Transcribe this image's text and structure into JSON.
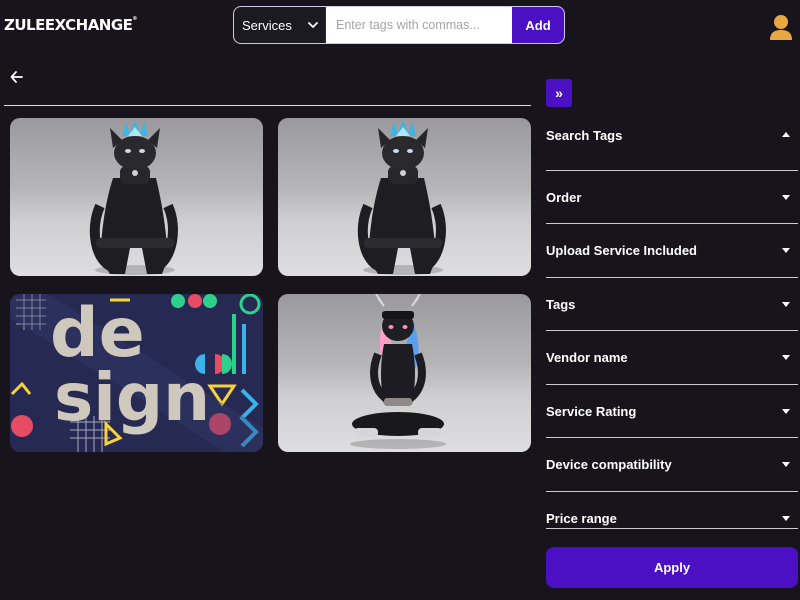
{
  "header": {
    "logo_text": "ZULEEXCHANGE",
    "logo_mark": "®",
    "search": {
      "category_selected": "Services",
      "placeholder": "Enter tags with commas...",
      "add_label": "Add"
    },
    "avatar_icon": "user-avatar-icon"
  },
  "main": {
    "back_icon": "arrow-left-icon",
    "items": [
      {
        "kind": "avatar-render",
        "title": "Black cat avatar with blue flame crown, seated"
      },
      {
        "kind": "avatar-render",
        "title": "Black cat avatar with blue flame crown, seated"
      },
      {
        "kind": "design-banner",
        "banner_text_1": "de",
        "banner_text_2": "sign"
      },
      {
        "kind": "avatar-render",
        "title": "Avatar with antlers and pink hair, sitting cross-legged"
      }
    ]
  },
  "sidebar": {
    "collapse_icon": "double-chevron-right-icon",
    "filters": [
      {
        "label": "Search Tags",
        "expanded": true
      },
      {
        "label": "Order",
        "expanded": false
      },
      {
        "label": "Upload Service Included",
        "expanded": false
      },
      {
        "label": "Tags",
        "expanded": false
      },
      {
        "label": "Vendor name",
        "expanded": false
      },
      {
        "label": "Service Rating",
        "expanded": false
      },
      {
        "label": "Device compatibility",
        "expanded": false
      },
      {
        "label": "Price range",
        "expanded": false
      }
    ],
    "apply_label": "Apply"
  },
  "colors": {
    "background": "#17151b",
    "accent": "#4b0fc4",
    "divider": "#c9c9ce"
  }
}
